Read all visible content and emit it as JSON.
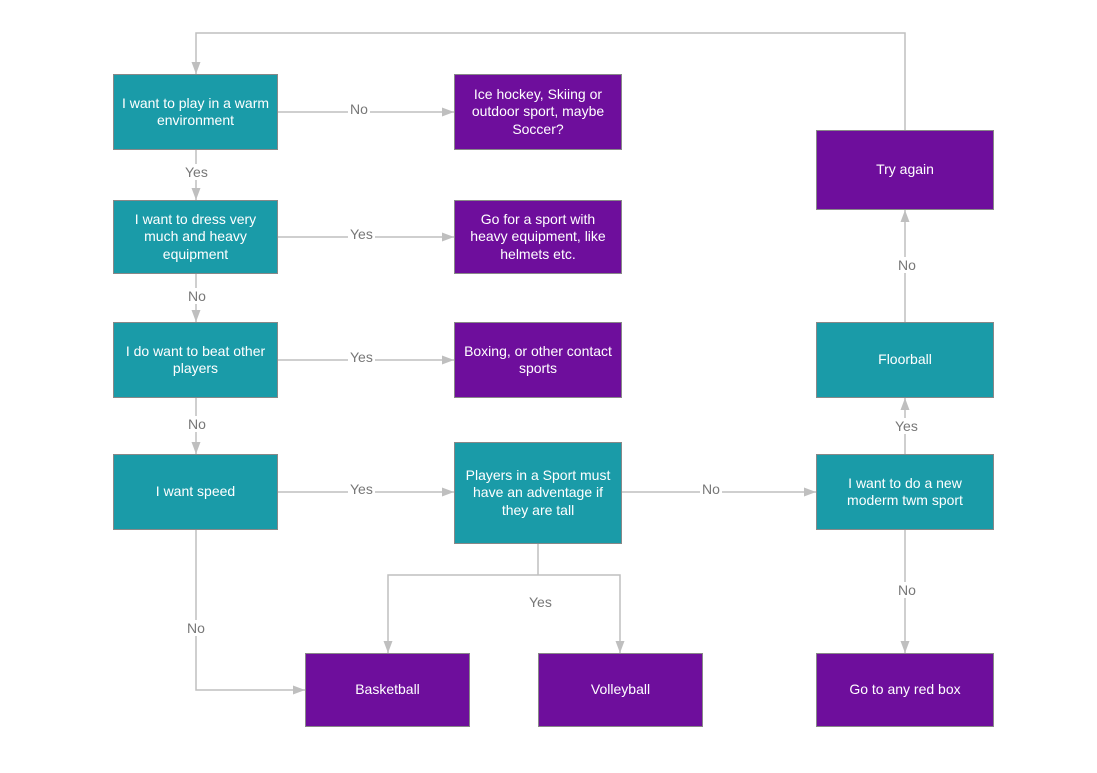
{
  "colors": {
    "teal": "#1a9ba8",
    "purple": "#6e0e9c",
    "arrow": "#bfbfbf",
    "label": "#777777"
  },
  "nodes": {
    "warm": "I want to play in a warm environment",
    "dress": "I want to dress very much and heavy equipment",
    "beat": "I do want to beat other players",
    "speed": "I want speed",
    "tall": "Players in a  Sport must have an adventage if they are tall",
    "modern": "I want to do a new moderm twm sport",
    "floorball": "Floorball",
    "tryagain": "Try again",
    "icehockey": "Ice hockey, Skiing or outdoor sport, maybe Soccer?",
    "heavy": "Go for a sport with heavy equipment, like helmets etc.",
    "boxing": "Boxing, or other contact sports",
    "basket": "Basketball",
    "volley": "Volleyball",
    "redbox": "Go to any red box"
  },
  "labels": {
    "yes": "Yes",
    "no": "No"
  }
}
